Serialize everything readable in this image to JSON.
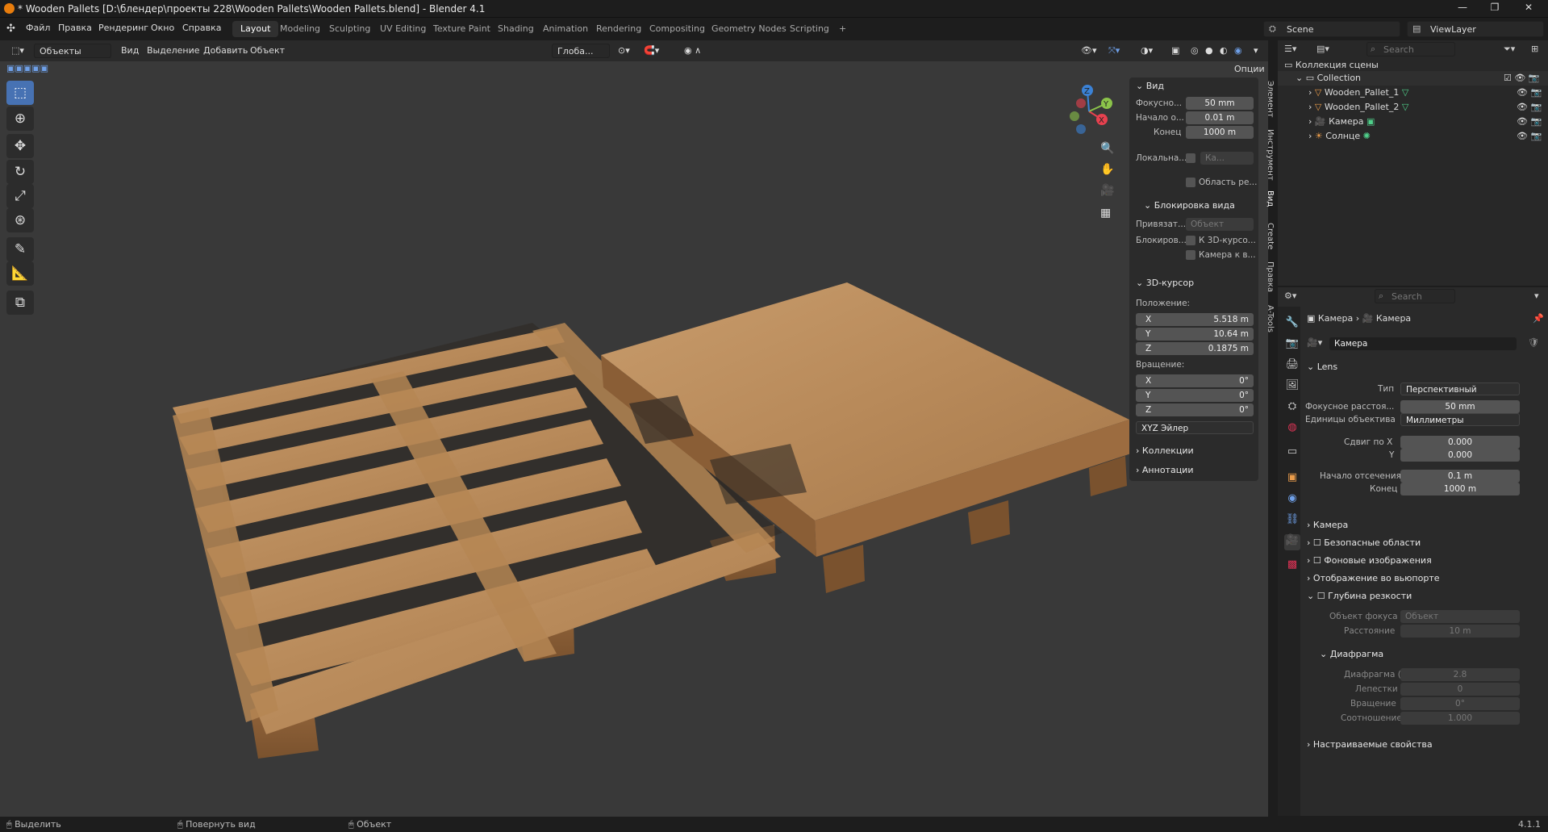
{
  "window": {
    "title": "* Wooden Pallets [D:\\блендер\\проекты 228\\Wooden Pallets\\Wooden Pallets.blend] - Blender 4.1",
    "controls": [
      "—",
      "❐",
      "✕"
    ]
  },
  "menu": [
    "Файл",
    "Правка",
    "Рендеринг",
    "Окно",
    "Справка"
  ],
  "workspaces": [
    "Layout",
    "Modeling",
    "Sculpting",
    "UV Editing",
    "Texture Paint",
    "Shading",
    "Animation",
    "Rendering",
    "Compositing",
    "Geometry Nodes",
    "Scripting"
  ],
  "workspace_add": "+",
  "scene": {
    "scene_name": "Scene",
    "view_layer": "ViewLayer"
  },
  "viewport_header": {
    "mode": "Объекты",
    "menus": [
      "Вид",
      "Выделение",
      "Добавить",
      "Объект"
    ],
    "orientation": "Глоба...",
    "options": "Опции"
  },
  "npanel": {
    "tabs": [
      "Элемент",
      "Инструмент",
      "Вид",
      "Create",
      "Правка",
      "A-Tools"
    ],
    "view": {
      "title": "Вид",
      "focal_label": "Фокусно...",
      "focal": "50 mm",
      "clip_start_label": "Начало о...",
      "clip_start": "0.01 m",
      "clip_end_label": "Конец",
      "clip_end": "1000 m",
      "local_label": "Локальна...",
      "local_value": "Ка...",
      "region_label": "Область ре...",
      "lock_title": "Блокировка вида",
      "lock_obj_label": "Привязат...",
      "lock_obj_value": "Объект",
      "lock_label": "Блокиров...",
      "lock_cursor": "К 3D-курсо...",
      "cam_to_view": "Камера к в..."
    },
    "cursor": {
      "title": "3D-курсор",
      "location_label": "Положение:",
      "x": "5.518 m",
      "y": "10.64 m",
      "z": "0.1875 m",
      "rotation_label": "Вращение:",
      "rx": "0°",
      "ry": "0°",
      "rz": "0°",
      "mode": "XYZ Эйлер",
      "axis_x": "X",
      "axis_y": "Y",
      "axis_z": "Z"
    },
    "collections": "Коллекции",
    "annotations": "Аннотации"
  },
  "outliner": {
    "search_placeholder": "Search",
    "root": "Коллекция сцены",
    "collection": "Collection",
    "items": [
      "Wooden_Pallet_1",
      "Wooden_Pallet_2",
      "Камера",
      "Солнце"
    ]
  },
  "properties": {
    "search_placeholder": "Search",
    "breadcrumb_1": "Камера",
    "breadcrumb_2": "Камера",
    "datablock": "Камера",
    "lens_title": "Lens",
    "type_label": "Тип",
    "type_value": "Перспективный",
    "focal_label": "Фокусное расстоя...",
    "focal_value": "50 mm",
    "units_label": "Единицы объектива",
    "units_value": "Миллиметры",
    "shift_x_label": "Сдвиг по X",
    "shift_x": "0.000",
    "shift_y_label": "Y",
    "shift_y": "0.000",
    "clip_start_label": "Начало отсечения",
    "clip_start": "0.1 m",
    "clip_end_label": "Конец",
    "clip_end": "1000 m",
    "sections": [
      "Камера",
      "Безопасные области",
      "Фоновые изображения",
      "Отображение во вьюпорте"
    ],
    "dof_title": "Глубина резкости",
    "focus_obj_label": "Объект фокуса",
    "focus_obj_value": "Объект",
    "distance_label": "Расстояние",
    "distance_value": "10 m",
    "aperture_title": "Диафрагма",
    "fstop_label": "Диафрагма (F)",
    "fstop_value": "2.8",
    "blades_label": "Лепестки",
    "blades_value": "0",
    "rotation_label": "Вращение",
    "rotation_value": "0°",
    "ratio_label": "Соотношение",
    "ratio_value": "1.000",
    "custom_props": "Настраиваемые свойства"
  },
  "status": {
    "select": "Выделить",
    "rotate": "Повернуть вид",
    "object": "Объект",
    "version": "4.1.1"
  },
  "colors": {
    "accent": "#4772b3",
    "axis_x": "#e8414f",
    "axis_y": "#8bc34a",
    "axis_z": "#3b82d6",
    "wood": "#b88a5a"
  }
}
